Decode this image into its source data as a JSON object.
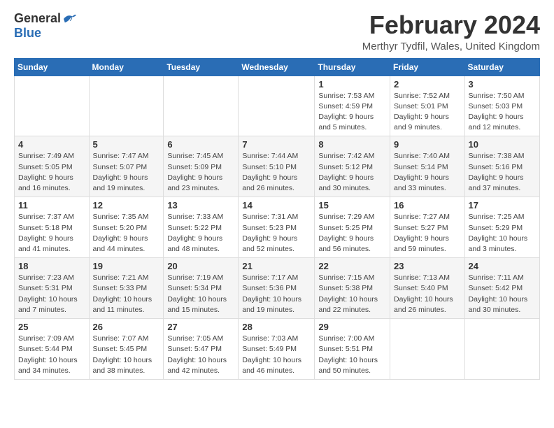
{
  "logo": {
    "general": "General",
    "blue": "Blue"
  },
  "title": {
    "month_year": "February 2024",
    "location": "Merthyr Tydfil, Wales, United Kingdom"
  },
  "headers": [
    "Sunday",
    "Monday",
    "Tuesday",
    "Wednesday",
    "Thursday",
    "Friday",
    "Saturday"
  ],
  "weeks": [
    [
      {
        "day": "",
        "detail": ""
      },
      {
        "day": "",
        "detail": ""
      },
      {
        "day": "",
        "detail": ""
      },
      {
        "day": "",
        "detail": ""
      },
      {
        "day": "1",
        "detail": "Sunrise: 7:53 AM\nSunset: 4:59 PM\nDaylight: 9 hours\nand 5 minutes."
      },
      {
        "day": "2",
        "detail": "Sunrise: 7:52 AM\nSunset: 5:01 PM\nDaylight: 9 hours\nand 9 minutes."
      },
      {
        "day": "3",
        "detail": "Sunrise: 7:50 AM\nSunset: 5:03 PM\nDaylight: 9 hours\nand 12 minutes."
      }
    ],
    [
      {
        "day": "4",
        "detail": "Sunrise: 7:49 AM\nSunset: 5:05 PM\nDaylight: 9 hours\nand 16 minutes."
      },
      {
        "day": "5",
        "detail": "Sunrise: 7:47 AM\nSunset: 5:07 PM\nDaylight: 9 hours\nand 19 minutes."
      },
      {
        "day": "6",
        "detail": "Sunrise: 7:45 AM\nSunset: 5:09 PM\nDaylight: 9 hours\nand 23 minutes."
      },
      {
        "day": "7",
        "detail": "Sunrise: 7:44 AM\nSunset: 5:10 PM\nDaylight: 9 hours\nand 26 minutes."
      },
      {
        "day": "8",
        "detail": "Sunrise: 7:42 AM\nSunset: 5:12 PM\nDaylight: 9 hours\nand 30 minutes."
      },
      {
        "day": "9",
        "detail": "Sunrise: 7:40 AM\nSunset: 5:14 PM\nDaylight: 9 hours\nand 33 minutes."
      },
      {
        "day": "10",
        "detail": "Sunrise: 7:38 AM\nSunset: 5:16 PM\nDaylight: 9 hours\nand 37 minutes."
      }
    ],
    [
      {
        "day": "11",
        "detail": "Sunrise: 7:37 AM\nSunset: 5:18 PM\nDaylight: 9 hours\nand 41 minutes."
      },
      {
        "day": "12",
        "detail": "Sunrise: 7:35 AM\nSunset: 5:20 PM\nDaylight: 9 hours\nand 44 minutes."
      },
      {
        "day": "13",
        "detail": "Sunrise: 7:33 AM\nSunset: 5:22 PM\nDaylight: 9 hours\nand 48 minutes."
      },
      {
        "day": "14",
        "detail": "Sunrise: 7:31 AM\nSunset: 5:23 PM\nDaylight: 9 hours\nand 52 minutes."
      },
      {
        "day": "15",
        "detail": "Sunrise: 7:29 AM\nSunset: 5:25 PM\nDaylight: 9 hours\nand 56 minutes."
      },
      {
        "day": "16",
        "detail": "Sunrise: 7:27 AM\nSunset: 5:27 PM\nDaylight: 9 hours\nand 59 minutes."
      },
      {
        "day": "17",
        "detail": "Sunrise: 7:25 AM\nSunset: 5:29 PM\nDaylight: 10 hours\nand 3 minutes."
      }
    ],
    [
      {
        "day": "18",
        "detail": "Sunrise: 7:23 AM\nSunset: 5:31 PM\nDaylight: 10 hours\nand 7 minutes."
      },
      {
        "day": "19",
        "detail": "Sunrise: 7:21 AM\nSunset: 5:33 PM\nDaylight: 10 hours\nand 11 minutes."
      },
      {
        "day": "20",
        "detail": "Sunrise: 7:19 AM\nSunset: 5:34 PM\nDaylight: 10 hours\nand 15 minutes."
      },
      {
        "day": "21",
        "detail": "Sunrise: 7:17 AM\nSunset: 5:36 PM\nDaylight: 10 hours\nand 19 minutes."
      },
      {
        "day": "22",
        "detail": "Sunrise: 7:15 AM\nSunset: 5:38 PM\nDaylight: 10 hours\nand 22 minutes."
      },
      {
        "day": "23",
        "detail": "Sunrise: 7:13 AM\nSunset: 5:40 PM\nDaylight: 10 hours\nand 26 minutes."
      },
      {
        "day": "24",
        "detail": "Sunrise: 7:11 AM\nSunset: 5:42 PM\nDaylight: 10 hours\nand 30 minutes."
      }
    ],
    [
      {
        "day": "25",
        "detail": "Sunrise: 7:09 AM\nSunset: 5:44 PM\nDaylight: 10 hours\nand 34 minutes."
      },
      {
        "day": "26",
        "detail": "Sunrise: 7:07 AM\nSunset: 5:45 PM\nDaylight: 10 hours\nand 38 minutes."
      },
      {
        "day": "27",
        "detail": "Sunrise: 7:05 AM\nSunset: 5:47 PM\nDaylight: 10 hours\nand 42 minutes."
      },
      {
        "day": "28",
        "detail": "Sunrise: 7:03 AM\nSunset: 5:49 PM\nDaylight: 10 hours\nand 46 minutes."
      },
      {
        "day": "29",
        "detail": "Sunrise: 7:00 AM\nSunset: 5:51 PM\nDaylight: 10 hours\nand 50 minutes."
      },
      {
        "day": "",
        "detail": ""
      },
      {
        "day": "",
        "detail": ""
      }
    ]
  ]
}
